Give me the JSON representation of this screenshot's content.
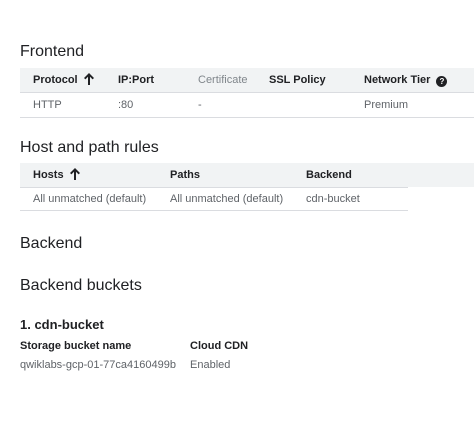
{
  "frontend": {
    "title": "Frontend",
    "columns": [
      "Protocol",
      "IP:Port",
      "Certificate",
      "SSL Policy",
      "Network Tier"
    ],
    "rows": [
      [
        "HTTP",
        ":80",
        "-",
        "",
        "Premium"
      ]
    ],
    "help_glyph": "?"
  },
  "host_rules": {
    "title": "Host and path rules",
    "columns": [
      "Hosts",
      "Paths",
      "Backend"
    ],
    "rows": [
      [
        "All unmatched (default)",
        "All unmatched (default)",
        "cdn-bucket"
      ]
    ]
  },
  "backend": {
    "title": "Backend",
    "buckets_title": "Backend buckets",
    "bucket": {
      "title": "1. cdn-bucket",
      "storage_label": "Storage bucket name",
      "storage_value": "qwiklabs-gcp-01-77ca4160499b",
      "cdn_label": "Cloud CDN",
      "cdn_value": "Enabled"
    }
  }
}
